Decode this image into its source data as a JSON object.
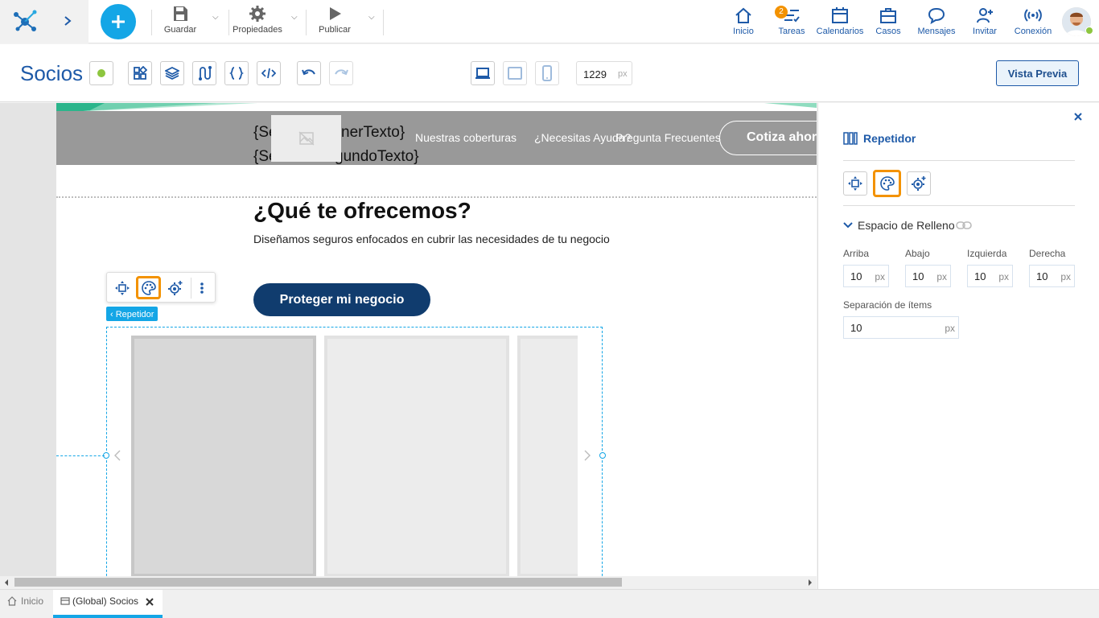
{
  "topbar": {
    "save_label": "Guardar",
    "properties_label": "Propiedades",
    "publish_label": "Publicar",
    "nav": [
      {
        "label": "Inicio",
        "icon": "home-icon"
      },
      {
        "label": "Tareas",
        "icon": "tasks-icon",
        "badge": "2"
      },
      {
        "label": "Calendarios",
        "icon": "calendar-icon"
      },
      {
        "label": "Casos",
        "icon": "briefcase-icon"
      },
      {
        "label": "Mensajes",
        "icon": "chat-icon"
      },
      {
        "label": "Invitar",
        "icon": "invite-icon"
      },
      {
        "label": "Conexión",
        "icon": "connection-icon"
      }
    ]
  },
  "editor": {
    "page_title": "Socios",
    "width_value": "1229",
    "width_unit": "px",
    "preview_label": "Vista Previa"
  },
  "canvas": {
    "nav_first_text": "{SegundoPrimerTexto}",
    "nav_second_text": "{SegundoSegundoTexto}",
    "nav_first_visible_a": "{Se",
    "nav_first_visible_b": "nerTexto}",
    "nav_second_visible_a": "{Se",
    "nav_second_visible_b": "gundoTexto}",
    "nav_link_1": "Nuestras coberturas",
    "nav_link_2": "¿Necesitas Ayuda?",
    "nav_link_3": "Pregunta Frecuentes",
    "cta_nav": "Cotiza ahora",
    "heading": "¿Qué te ofrecemos?",
    "subheading": "Diseñamos seguros enfocados en cubrir las necesidades de tu negocio",
    "primary_button": "Proteger mi negocio",
    "repeater_tag": "‹ Repetidor"
  },
  "panel": {
    "title": "Repetidor",
    "section_title": "Espacio de Relleno",
    "fields": [
      {
        "label": "Arriba",
        "value": "10",
        "unit": "px"
      },
      {
        "label": "Abajo",
        "value": "10",
        "unit": "px"
      },
      {
        "label": "Izquierda",
        "value": "10",
        "unit": "px"
      },
      {
        "label": "Derecha",
        "value": "10",
        "unit": "px"
      }
    ],
    "spacing_label": "Separación de ítems",
    "spacing_value": "10",
    "spacing_unit": "px"
  },
  "tabs": [
    {
      "label": "Inicio",
      "active": false
    },
    {
      "label": "(Global) Socios",
      "active": true
    }
  ],
  "colors": {
    "brand_blue": "#1e5aa8",
    "accent_cyan": "#14a6e6",
    "highlight_orange": "#f39200",
    "navy_button": "#103c6e"
  }
}
